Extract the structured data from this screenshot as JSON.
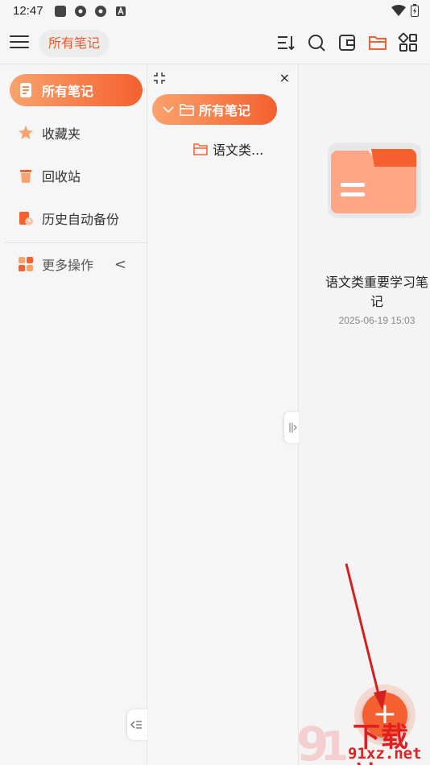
{
  "status_bar": {
    "time": "12:47"
  },
  "toolbar": {
    "breadcrumb": "所有笔记",
    "icons": [
      "sort-icon",
      "search-icon",
      "wallet-icon",
      "folder-icon",
      "grid-icon"
    ]
  },
  "sidebar": {
    "items": [
      {
        "label": "所有笔记",
        "icon": "notes-icon"
      },
      {
        "label": "收藏夹",
        "icon": "star-icon"
      },
      {
        "label": "回收站",
        "icon": "trash-icon"
      },
      {
        "label": "历史自动备份",
        "icon": "backup-icon"
      }
    ],
    "more": {
      "label": "更多操作",
      "chevron": "<"
    }
  },
  "tree": {
    "close": "×",
    "root": "所有笔记",
    "child": "语文类..."
  },
  "content": {
    "note_title": "语文类重要学习笔记",
    "note_date": "2025-06-19 15:03"
  },
  "fab": {
    "label": "+"
  },
  "watermark": {
    "text": "下载站",
    "url": "91xz.net"
  },
  "colors": {
    "accent": "#f4602f",
    "accent_light": "#f9a36d",
    "arrow": "#d42020"
  }
}
